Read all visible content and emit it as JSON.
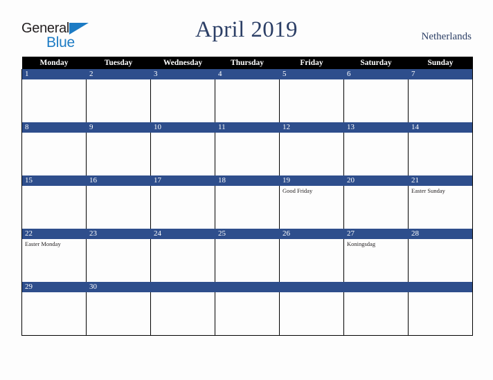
{
  "brand": {
    "name_part1": "General",
    "name_part2": "Blue",
    "triangle_icon": "triangle-icon",
    "colors": {
      "general_text": "#231f20",
      "blue_text": "#1c7bc4",
      "triangle": "#1c7bc4"
    }
  },
  "header": {
    "title": "April 2019",
    "country": "Netherlands",
    "title_color": "#2c3f66",
    "country_color": "#2c3f66"
  },
  "calendar": {
    "colors": {
      "weekday_header_bg": "#000000",
      "weekday_header_text": "#ffffff",
      "date_band_bg": "#2e4e8c",
      "date_text": "#ffffff",
      "cell_bg": "#fdfdfd",
      "grid_line": "#000000",
      "event_text": "#231f20"
    },
    "weekdays": [
      "Monday",
      "Tuesday",
      "Wednesday",
      "Thursday",
      "Friday",
      "Saturday",
      "Sunday"
    ],
    "weeks": [
      {
        "days": [
          {
            "date": "1",
            "events": []
          },
          {
            "date": "2",
            "events": []
          },
          {
            "date": "3",
            "events": []
          },
          {
            "date": "4",
            "events": []
          },
          {
            "date": "5",
            "events": []
          },
          {
            "date": "6",
            "events": []
          },
          {
            "date": "7",
            "events": []
          }
        ]
      },
      {
        "days": [
          {
            "date": "8",
            "events": []
          },
          {
            "date": "9",
            "events": []
          },
          {
            "date": "10",
            "events": []
          },
          {
            "date": "11",
            "events": []
          },
          {
            "date": "12",
            "events": []
          },
          {
            "date": "13",
            "events": []
          },
          {
            "date": "14",
            "events": []
          }
        ]
      },
      {
        "days": [
          {
            "date": "15",
            "events": []
          },
          {
            "date": "16",
            "events": []
          },
          {
            "date": "17",
            "events": []
          },
          {
            "date": "18",
            "events": []
          },
          {
            "date": "19",
            "events": [
              "Good Friday"
            ]
          },
          {
            "date": "20",
            "events": []
          },
          {
            "date": "21",
            "events": [
              "Easter Sunday"
            ]
          }
        ]
      },
      {
        "days": [
          {
            "date": "22",
            "events": [
              "Easter Monday"
            ]
          },
          {
            "date": "23",
            "events": []
          },
          {
            "date": "24",
            "events": []
          },
          {
            "date": "25",
            "events": []
          },
          {
            "date": "26",
            "events": []
          },
          {
            "date": "27",
            "events": [
              "Koningsdag"
            ]
          },
          {
            "date": "28",
            "events": []
          }
        ]
      },
      {
        "days": [
          {
            "date": "29",
            "events": []
          },
          {
            "date": "30",
            "events": []
          },
          {
            "date": "",
            "events": []
          },
          {
            "date": "",
            "events": []
          },
          {
            "date": "",
            "events": []
          },
          {
            "date": "",
            "events": []
          },
          {
            "date": "",
            "events": []
          }
        ]
      }
    ]
  }
}
